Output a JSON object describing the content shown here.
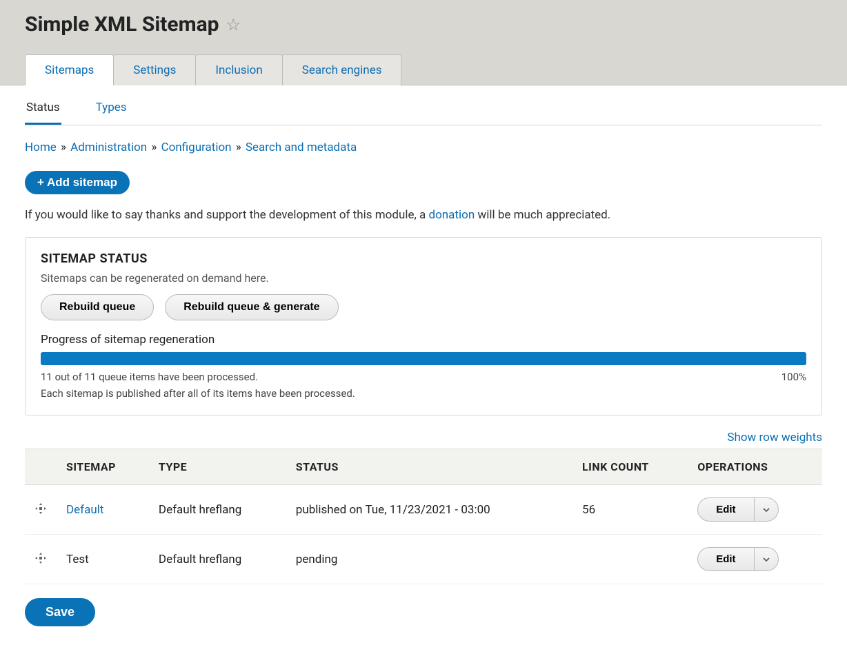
{
  "header": {
    "title": "Simple XML Sitemap"
  },
  "primary_tabs": {
    "sitemaps": "Sitemaps",
    "settings": "Settings",
    "inclusion": "Inclusion",
    "search_engines": "Search engines"
  },
  "secondary_tabs": {
    "status": "Status",
    "types": "Types"
  },
  "breadcrumb": {
    "home": "Home",
    "admin": "Administration",
    "config": "Configuration",
    "search_meta": "Search and metadata",
    "sep": "»"
  },
  "actions": {
    "add_sitemap": "Add sitemap",
    "plus": "+",
    "save": "Save"
  },
  "thanks": {
    "pre": "If you would like to say thanks and support the development of this module, a ",
    "link": "donation",
    "post": " will be much appreciated."
  },
  "status_box": {
    "legend": "SITEMAP STATUS",
    "desc": "Sitemaps can be regenerated on demand here.",
    "rebuild": "Rebuild queue",
    "rebuild_gen": "Rebuild queue & generate",
    "progress_label": "Progress of sitemap regeneration",
    "progress_text": "11 out of 11 queue items have been processed.",
    "progress_pct": "100%",
    "progress_note": "Each sitemap is published after all of its items have been processed."
  },
  "row_weights": "Show row weights",
  "table": {
    "headers": {
      "sitemap": "SITEMAP",
      "type": "TYPE",
      "status": "STATUS",
      "link_count": "LINK COUNT",
      "operations": "OPERATIONS"
    },
    "rows": [
      {
        "name": "Default",
        "type": "Default hreflang",
        "status": "published on Tue, 11/23/2021 - 03:00",
        "link_count": "56",
        "is_link": true
      },
      {
        "name": "Test",
        "type": "Default hreflang",
        "status": "pending",
        "link_count": "",
        "is_link": false
      }
    ],
    "edit": "Edit"
  }
}
